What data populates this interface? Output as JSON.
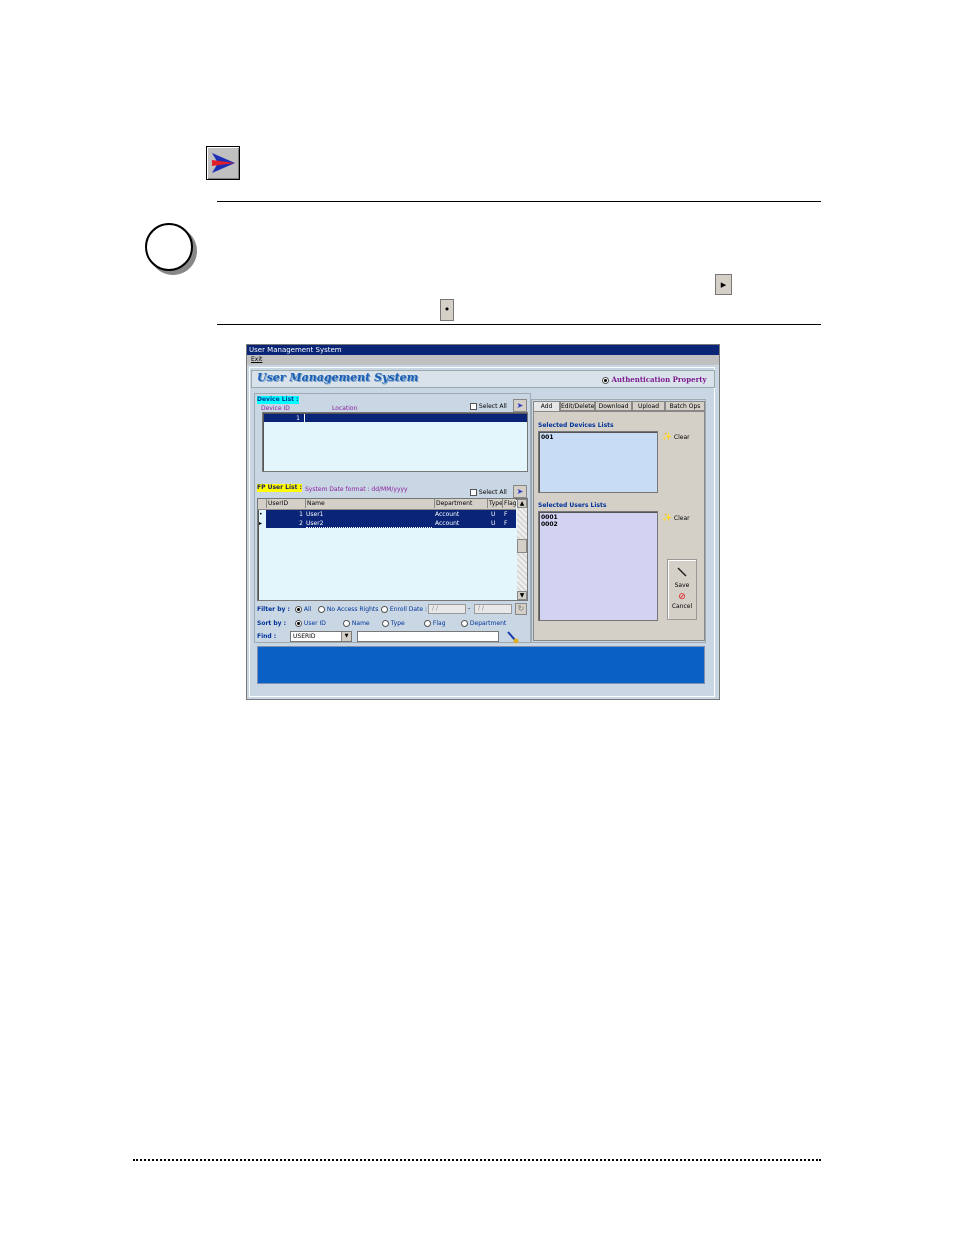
{
  "page": {
    "note_icon": "circle-note-icon",
    "expand_icon": "expand-arrow-icon",
    "record_dot_icon": "record-selector-dot-icon"
  },
  "window": {
    "title": "User Management System",
    "menu": [
      "Exit"
    ],
    "app_title": "User Management System",
    "auth_radio_label": "Authentication Property"
  },
  "device_list": {
    "label": "Device List :",
    "select_all": "Select All",
    "columns": [
      "Device ID",
      "Location"
    ],
    "rows": [
      {
        "device_id": "1",
        "location": ""
      }
    ]
  },
  "user_list": {
    "label": "FP User List :",
    "date_format": "System Date format : dd/MM/yyyy",
    "select_all": "Select All",
    "columns": [
      "UserID",
      "Name",
      "Department",
      "Type",
      "Flag"
    ],
    "rows": [
      {
        "marker": "•",
        "user_id": "1",
        "name": "User1",
        "department": "Account",
        "type": "U",
        "flag": "F"
      },
      {
        "marker": "▸",
        "user_id": "2",
        "name": "User2",
        "department": "Account",
        "type": "U",
        "flag": "F"
      }
    ]
  },
  "filter": {
    "label": "Filter by :",
    "options": [
      "All",
      "No Access Rights",
      "Enroll Date :"
    ],
    "date_from": "/ /",
    "date_sep": "-",
    "date_to": "/ /"
  },
  "sort": {
    "label": "Sort by :",
    "options": [
      "User ID",
      "Name",
      "Type",
      "Flag",
      "Department"
    ]
  },
  "find": {
    "label": "Find :",
    "field_value": "USERID",
    "text_value": ""
  },
  "tabs": [
    "Add",
    "Edit/Delete",
    "Download",
    "Upload",
    "Batch Ops"
  ],
  "right_panel": {
    "devices_label": "Selected Devices Lists",
    "devices": [
      "001"
    ],
    "users_label": "Selected Users Lists",
    "users": [
      "0001",
      "0002"
    ],
    "clear_label": "Clear",
    "save_label": "Save",
    "cancel_label": "Cancel"
  },
  "colors": {
    "title_bar": "#0a2575",
    "status_bar": "#0a60c4",
    "accent_purple": "#8b1fa0",
    "list_bg": "#e2f6fb"
  }
}
